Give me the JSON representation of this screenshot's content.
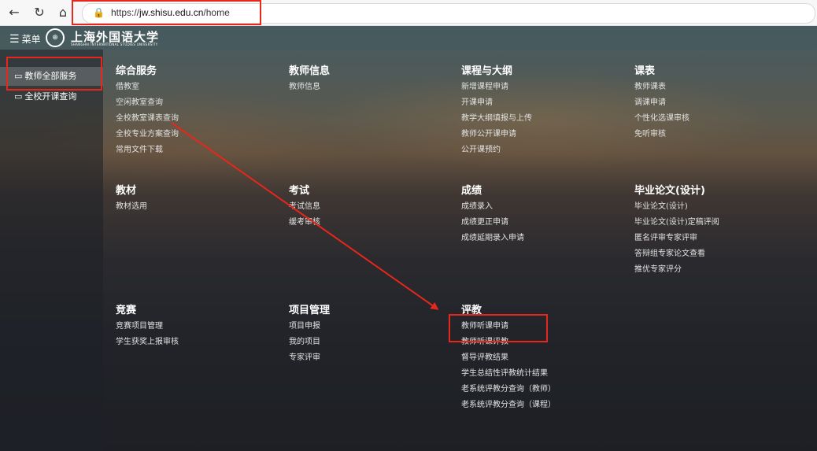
{
  "browser": {
    "url_prefix": "https://",
    "url_domain": "jw.shisu.edu.cn",
    "url_path": "/home"
  },
  "topbar": {
    "menu_label": "菜单",
    "logo_text": "上海外国语大学",
    "logo_subtitle": "SHANGHAI INTERNATIONAL STUDIES UNIVERSITY"
  },
  "sidebar": {
    "items": [
      {
        "label": "教师全部服务"
      },
      {
        "label": "全校开课查询"
      }
    ]
  },
  "sections": {
    "zhfw": {
      "title": "综合服务",
      "links": [
        "借教室",
        "空闲教室查询",
        "全校教室课表查询",
        "全校专业方案查询",
        "常用文件下载"
      ]
    },
    "jsxx": {
      "title": "教师信息",
      "links": [
        "教师信息"
      ]
    },
    "kcdg": {
      "title": "课程与大纲",
      "links": [
        "新增课程申请",
        "开课申请",
        "教学大纲填报与上传",
        "教师公开课申请",
        "公开课预约"
      ]
    },
    "kb": {
      "title": "课表",
      "links": [
        "教师课表",
        "调课申请",
        "个性化选课审核",
        "免听审核"
      ]
    },
    "jc": {
      "title": "教材",
      "links": [
        "教材选用"
      ]
    },
    "ks": {
      "title": "考试",
      "links": [
        "考试信息",
        "缓考审核"
      ]
    },
    "cj": {
      "title": "成绩",
      "links": [
        "成绩录入",
        "成绩更正申请",
        "成绩延期录入申请"
      ]
    },
    "bylw": {
      "title": "毕业论文(设计)",
      "links": [
        "毕业论文(设计)",
        "毕业论文(设计)定稿评阅",
        "匿名评审专家评审",
        "答辩组专家论文查看",
        "推优专家评分"
      ]
    },
    "js": {
      "title": "竞赛",
      "links": [
        "竞赛项目管理",
        "学生获奖上报审核"
      ]
    },
    "xmgl": {
      "title": "项目管理",
      "links": [
        "项目申报",
        "我的项目",
        "专家评审"
      ]
    },
    "pj": {
      "title": "评教",
      "links": [
        "教师听课申请",
        "教师听课评教",
        "督导评教结果",
        "学生总结性评教统计结果",
        "老系统评教分查询（教师）",
        "老系统评教分查询（课程）"
      ]
    }
  },
  "colors": {
    "annotation_red": "#e8261c"
  }
}
